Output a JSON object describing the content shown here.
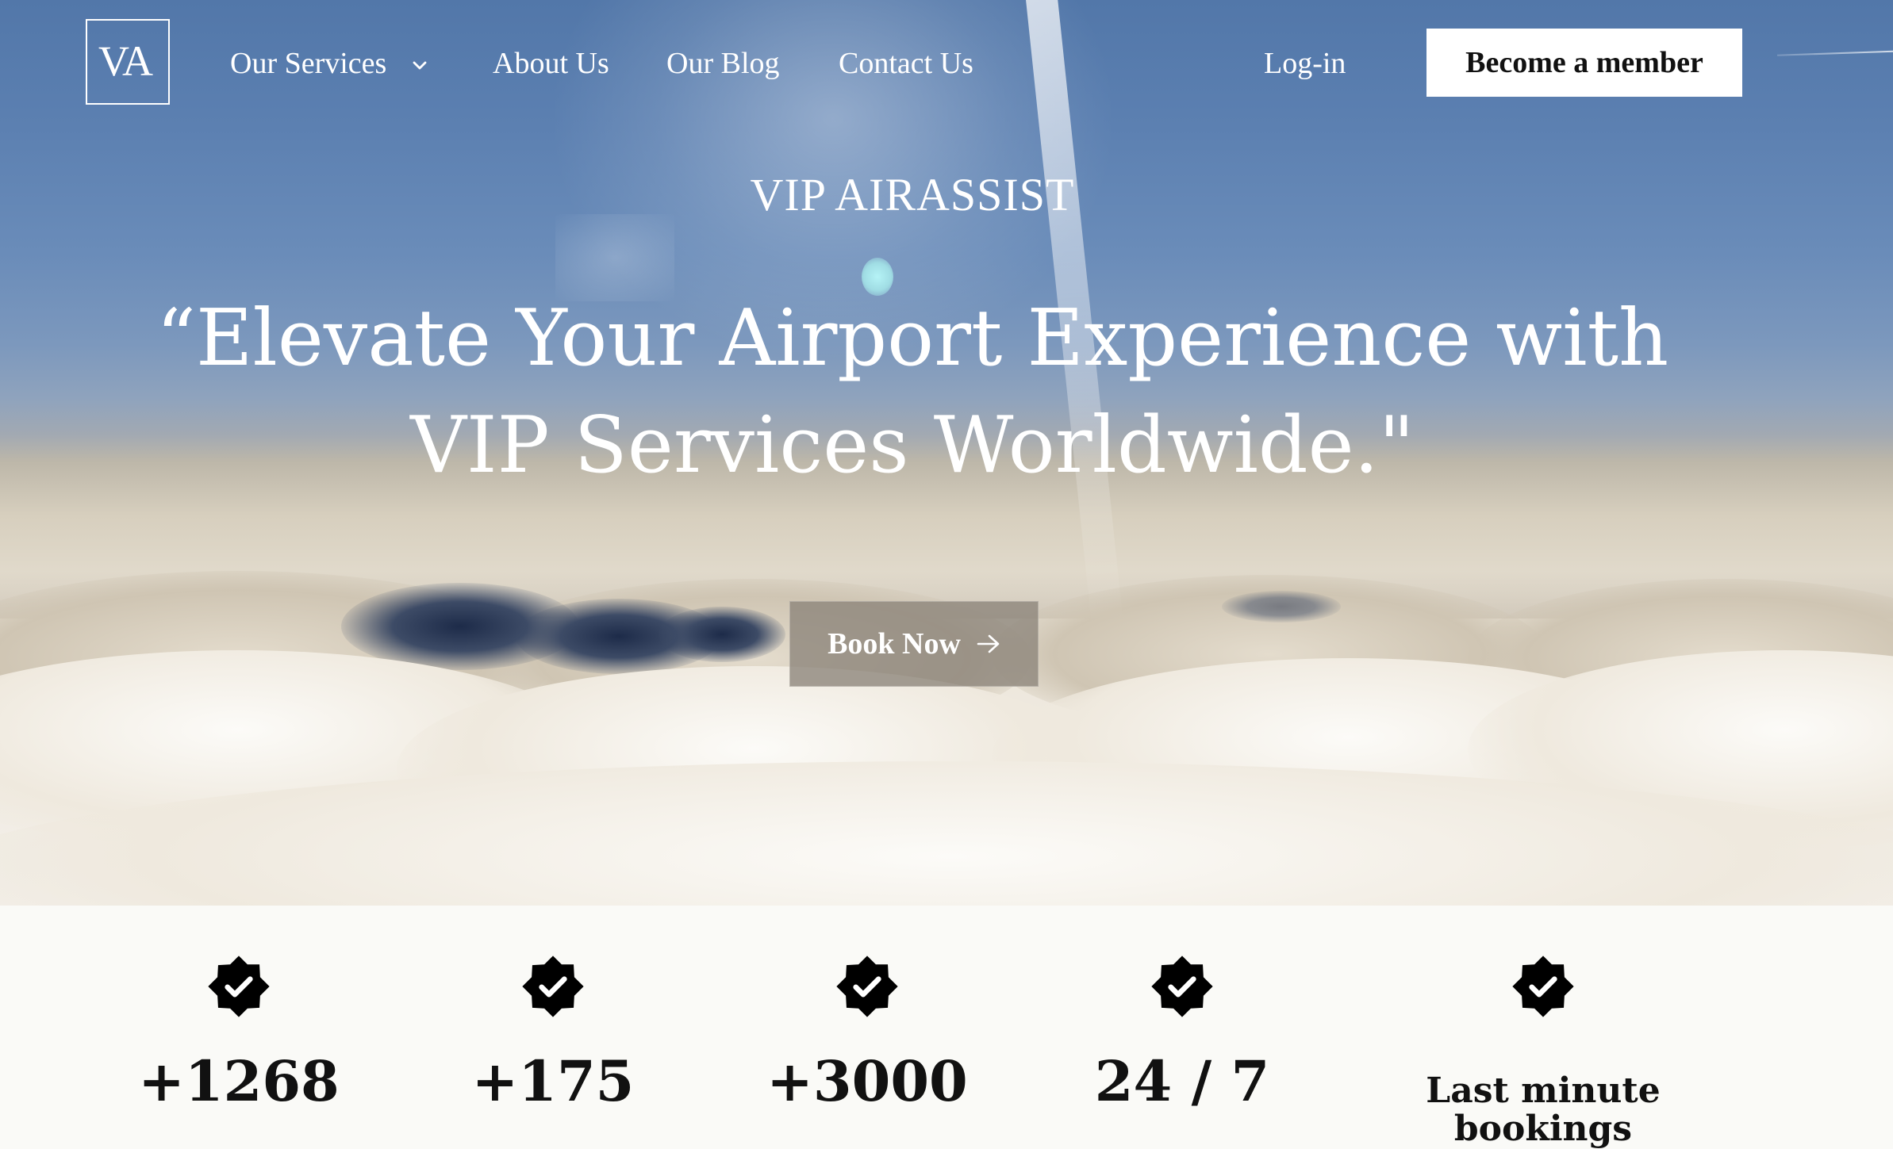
{
  "logo": {
    "text": "VA"
  },
  "nav": {
    "services": "Our Services",
    "about": "About Us",
    "blog": "Our Blog",
    "contact": "Contact Us",
    "login": "Log-in",
    "member": "Become a member"
  },
  "hero": {
    "brand": "VIP AIRASSIST",
    "headline": "“Elevate Your Airport Experience with VIP Services Worldwide.\"",
    "cta": "Book Now"
  },
  "stats": [
    {
      "value": "+1268"
    },
    {
      "value": "+175"
    },
    {
      "value": "+3000"
    },
    {
      "value": "24 / 7"
    },
    {
      "value": "Last minute bookings"
    }
  ],
  "colors": {
    "sky_top": "#5277a9",
    "text_white": "#ffffff",
    "text_dark": "#111111",
    "stats_background": "#fafaf7",
    "cta_background": "#8c847a"
  },
  "icons": {
    "nav_dropdown": "chevron-down-icon",
    "cta": "arrow-right-icon",
    "stat": "verified-badge-icon"
  }
}
